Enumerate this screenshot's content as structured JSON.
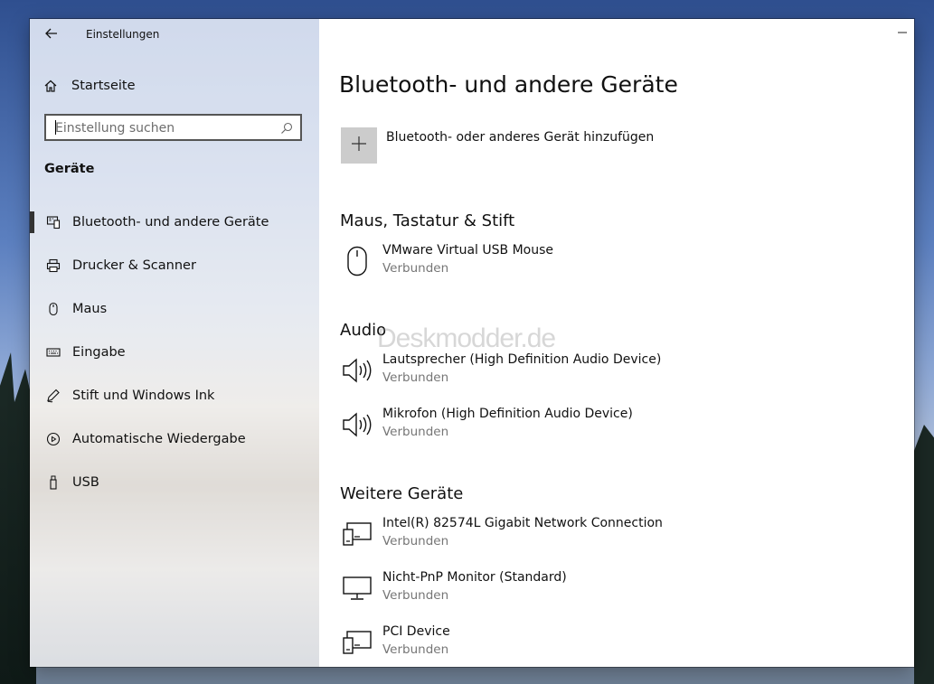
{
  "app": {
    "title": "Einstellungen"
  },
  "sidebar": {
    "home_label": "Startseite",
    "search_placeholder": "Einstellung suchen",
    "category": "Geräte",
    "items": [
      {
        "label": "Bluetooth- und andere Geräte",
        "icon": "bluetooth-devices-icon",
        "active": true
      },
      {
        "label": "Drucker & Scanner",
        "icon": "printer-icon",
        "active": false
      },
      {
        "label": "Maus",
        "icon": "mouse-icon",
        "active": false
      },
      {
        "label": "Eingabe",
        "icon": "keyboard-icon",
        "active": false
      },
      {
        "label": "Stift und Windows Ink",
        "icon": "pen-icon",
        "active": false
      },
      {
        "label": "Automatische Wiedergabe",
        "icon": "autoplay-icon",
        "active": false
      },
      {
        "label": "USB",
        "icon": "usb-icon",
        "active": false
      }
    ]
  },
  "main": {
    "title": "Bluetooth- und andere Geräte",
    "add_device_label": "Bluetooth- oder anderes Gerät hinzufügen",
    "watermark": "Deskmodder.de",
    "sections": [
      {
        "title": "Maus, Tastatur & Stift",
        "devices": [
          {
            "name": "VMware Virtual USB Mouse",
            "status": "Verbunden",
            "icon": "mouse-icon"
          }
        ]
      },
      {
        "title": "Audio",
        "devices": [
          {
            "name": "Lautsprecher (High Definition Audio Device)",
            "status": "Verbunden",
            "icon": "speaker-icon"
          },
          {
            "name": "Mikrofon (High Definition Audio Device)",
            "status": "Verbunden",
            "icon": "speaker-icon"
          }
        ]
      },
      {
        "title": "Weitere Geräte",
        "devices": [
          {
            "name": "Intel(R) 82574L Gigabit Network Connection",
            "status": "Verbunden",
            "icon": "devices-icon"
          },
          {
            "name": "Nicht-PnP Monitor (Standard)",
            "status": "Verbunden",
            "icon": "monitor-icon"
          },
          {
            "name": "PCI Device",
            "status": "Verbunden",
            "icon": "devices-icon"
          }
        ]
      }
    ]
  },
  "colors": {
    "active_indicator": "#333333",
    "status_text": "#767676",
    "add_button_bg": "#cccccc"
  }
}
